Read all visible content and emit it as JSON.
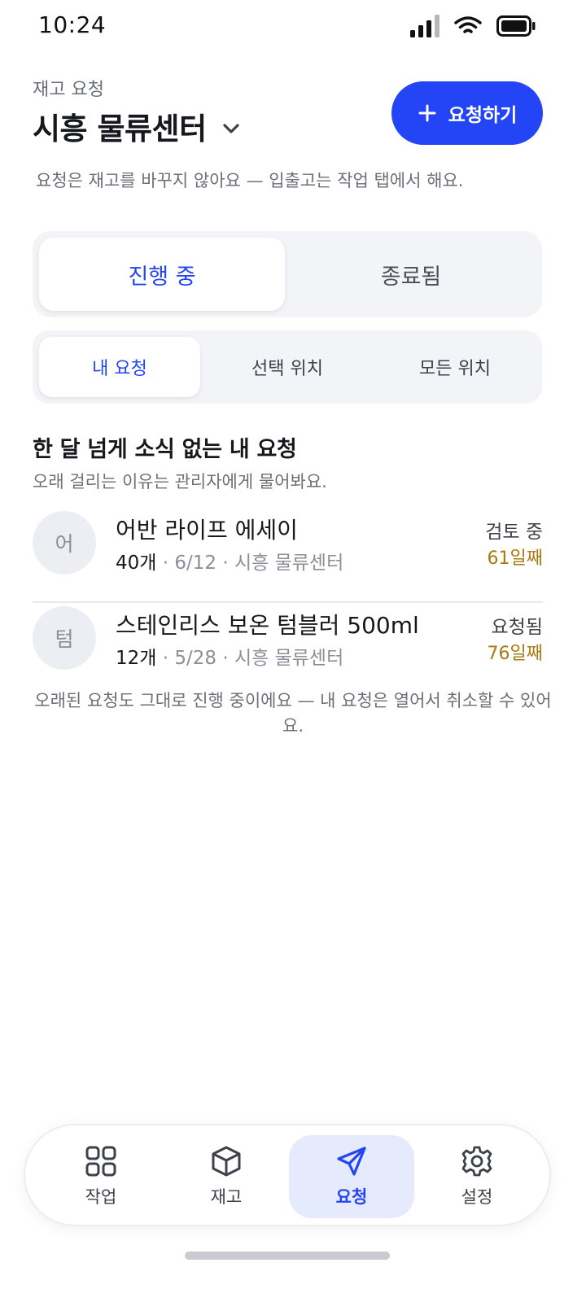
{
  "status_bar": {
    "time": "10:24"
  },
  "header": {
    "eyebrow": "재고 요청",
    "site": "시흥 물류센터",
    "new_request_label": "요청하기",
    "notice": "요청은 재고를 바꾸지 않아요 — 입출고는 작업 탭에서 해요."
  },
  "status_tabs": [
    {
      "label": "진행 중",
      "active": true
    },
    {
      "label": "종료됨",
      "active": false
    }
  ],
  "scope_tabs": [
    {
      "label": "내 요청",
      "active": true
    },
    {
      "label": "선택 위치",
      "active": false
    },
    {
      "label": "모든 위치",
      "active": false
    }
  ],
  "section": {
    "title": "한 달 넘게 소식 없는 내 요청",
    "subtitle": "오래 걸리는 이유는 관리자에게 물어봐요."
  },
  "requests": [
    {
      "initial": "어",
      "name": "어반 라이프 에세이",
      "qty": "40개",
      "details": " · 6/12 · 시흥 물류센터",
      "status": "검토 중",
      "age": "61일째"
    },
    {
      "initial": "텀",
      "name": "스테인리스 보온 텀블러 500ml",
      "qty": "12개",
      "details": " · 5/28 · 시흥 물류센터",
      "status": "요청됨",
      "age": "76일째"
    }
  ],
  "footnote": "오래된 요청도 그대로 진행 중이에요 — 내 요청은 열어서 취소할 수 있어요.",
  "tabbar": {
    "items": [
      {
        "label": "작업",
        "icon": "grid-icon",
        "active": false
      },
      {
        "label": "재고",
        "icon": "box-icon",
        "active": false
      },
      {
        "label": "요청",
        "icon": "send-icon",
        "active": true
      },
      {
        "label": "설정",
        "icon": "gear-icon",
        "active": false
      }
    ]
  },
  "colors": {
    "accent": "#2345f5",
    "accent_soft": "#e6eafd",
    "age_warning": "#a87a10"
  }
}
